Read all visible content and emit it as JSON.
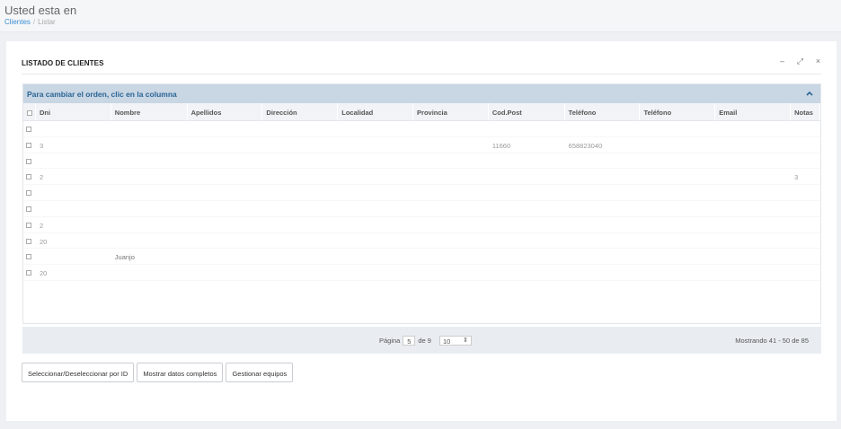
{
  "header": {
    "title": "Usted esta en",
    "breadcrumb": {
      "link": "Clientes",
      "separator": "/",
      "current": "Listar"
    }
  },
  "panel": {
    "title": "LISTADO DE CLIENTES",
    "tools": {
      "minimize": "–",
      "expand": "⤢",
      "close": "×"
    }
  },
  "grid": {
    "caption": "Para cambiar el orden, clic en la columna",
    "collapse_icon": "chevron-up-icon",
    "columns": [
      "Dni",
      "Nombre",
      "Apellidos",
      "Dirección",
      "Localidad",
      "Provincia",
      "Cod.Post",
      "Teléfono",
      "Teléfono",
      "Email",
      "Notas"
    ],
    "rows": [
      {
        "dni": "",
        "nombre": "",
        "apellidos": "",
        "direccion": "",
        "localidad": "",
        "provincia": "",
        "cp": "",
        "tel1": "",
        "tel2": "",
        "email": "",
        "notas": ""
      },
      {
        "dni": "3",
        "nombre": "",
        "apellidos": "",
        "direccion": "",
        "localidad": "",
        "provincia": "",
        "cp": "11660",
        "tel1": "658823040",
        "tel2": "",
        "email": "",
        "notas": ""
      },
      {
        "dni": "",
        "nombre": "",
        "apellidos": "",
        "direccion": "",
        "localidad": "",
        "provincia": "",
        "cp": "",
        "tel1": "",
        "tel2": "",
        "email": "",
        "notas": ""
      },
      {
        "dni": "2",
        "nombre": "",
        "apellidos": "",
        "direccion": "",
        "localidad": "",
        "provincia": "",
        "cp": "",
        "tel1": "",
        "tel2": "",
        "email": "",
        "notas": "3"
      },
      {
        "dni": "",
        "nombre": "",
        "apellidos": "",
        "direccion": "",
        "localidad": "",
        "provincia": "",
        "cp": "",
        "tel1": "",
        "tel2": "",
        "email": "",
        "notas": ""
      },
      {
        "dni": "",
        "nombre": "",
        "apellidos": "",
        "direccion": "",
        "localidad": "",
        "provincia": "",
        "cp": "",
        "tel1": "",
        "tel2": "",
        "email": "",
        "notas": ""
      },
      {
        "dni": "2",
        "nombre": "",
        "apellidos": "",
        "direccion": "",
        "localidad": "",
        "provincia": "",
        "cp": "",
        "tel1": "",
        "tel2": "",
        "email": "",
        "notas": ""
      },
      {
        "dni": "20",
        "nombre": "",
        "apellidos": "",
        "direccion": "",
        "localidad": "",
        "provincia": "",
        "cp": "",
        "tel1": "",
        "tel2": "",
        "email": "",
        "notas": ""
      },
      {
        "dni": "",
        "nombre": "Juanjo",
        "apellidos": "",
        "direccion": "",
        "localidad": "",
        "provincia": "",
        "cp": "",
        "tel1": "",
        "tel2": "",
        "email": "",
        "notas": ""
      },
      {
        "dni": "20",
        "nombre": "",
        "apellidos": "",
        "direccion": "",
        "localidad": "",
        "provincia": "",
        "cp": "",
        "tel1": "",
        "tel2": "",
        "email": "",
        "notas": ""
      }
    ]
  },
  "footer": {
    "page_label": "Página",
    "page_value": "5",
    "of_label": "de 9",
    "rows_per_page": "10",
    "summary": "Mostrando 41 - 50 de 85"
  },
  "buttons": {
    "select_by_id": "Seleccionar/Deseleccionar por ID",
    "show_full": "Mostrar datos completos",
    "manage_equipment": "Gestionar equipos"
  },
  "colors": {
    "accent": "#2a6596",
    "caption_bg": "#c9d6e3",
    "link": "#3a8fd0"
  }
}
